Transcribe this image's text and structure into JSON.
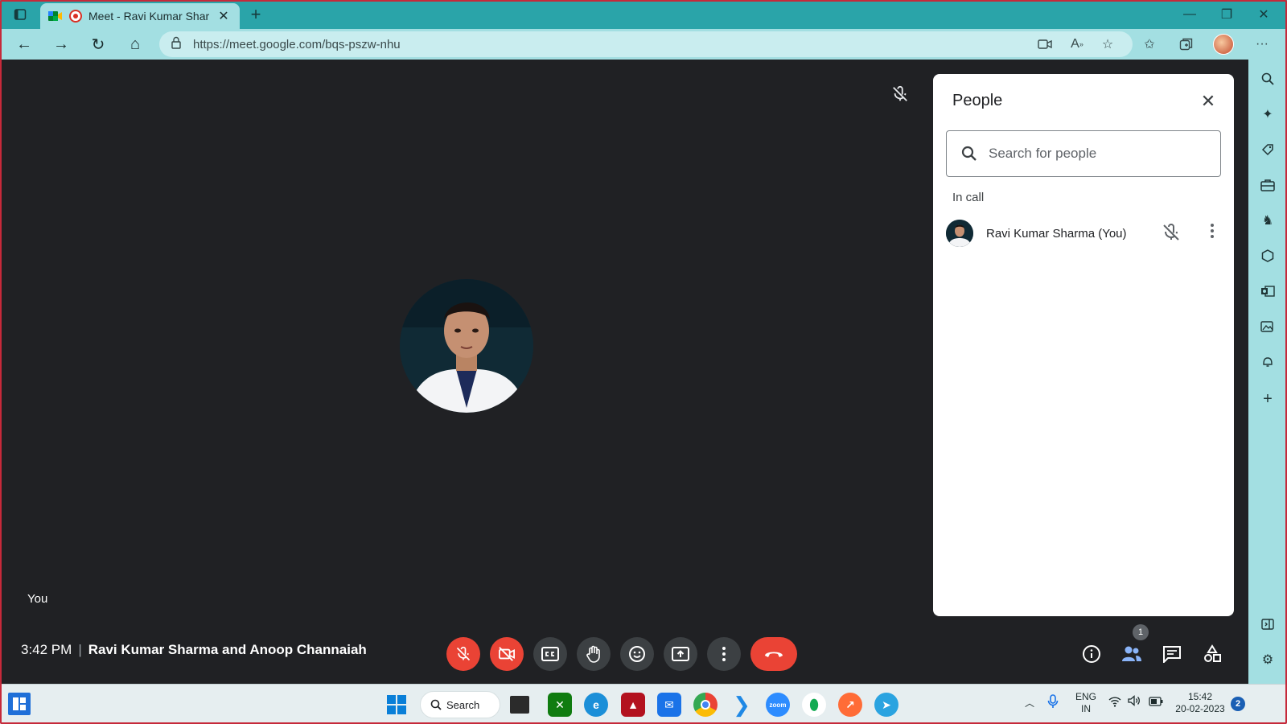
{
  "browser": {
    "tab_title": "Meet - Ravi Kumar Sharma a",
    "url": "https://meet.google.com/bqs-pszw-nhu"
  },
  "meet": {
    "tile_label": "You",
    "time": "3:42 PM",
    "separator": "|",
    "meeting_name": "Ravi Kumar Sharma and Anoop Channaiah",
    "participant_count": "1"
  },
  "people_panel": {
    "title": "People",
    "search_placeholder": "Search for people",
    "section_label": "In call",
    "participants": [
      {
        "name": "Ravi Kumar Sharma (You)"
      }
    ]
  },
  "taskbar": {
    "search_label": "Search",
    "lang_top": "ENG",
    "lang_bottom": "IN",
    "clock_time": "15:42",
    "clock_date": "20-02-2023",
    "notification_count": "2",
    "zoom_label": "zoom"
  },
  "colors": {
    "accent_teal": "#2aa4a9",
    "meet_bg": "#202124",
    "danger_red": "#ea4335",
    "control_grey": "#3c4043"
  }
}
